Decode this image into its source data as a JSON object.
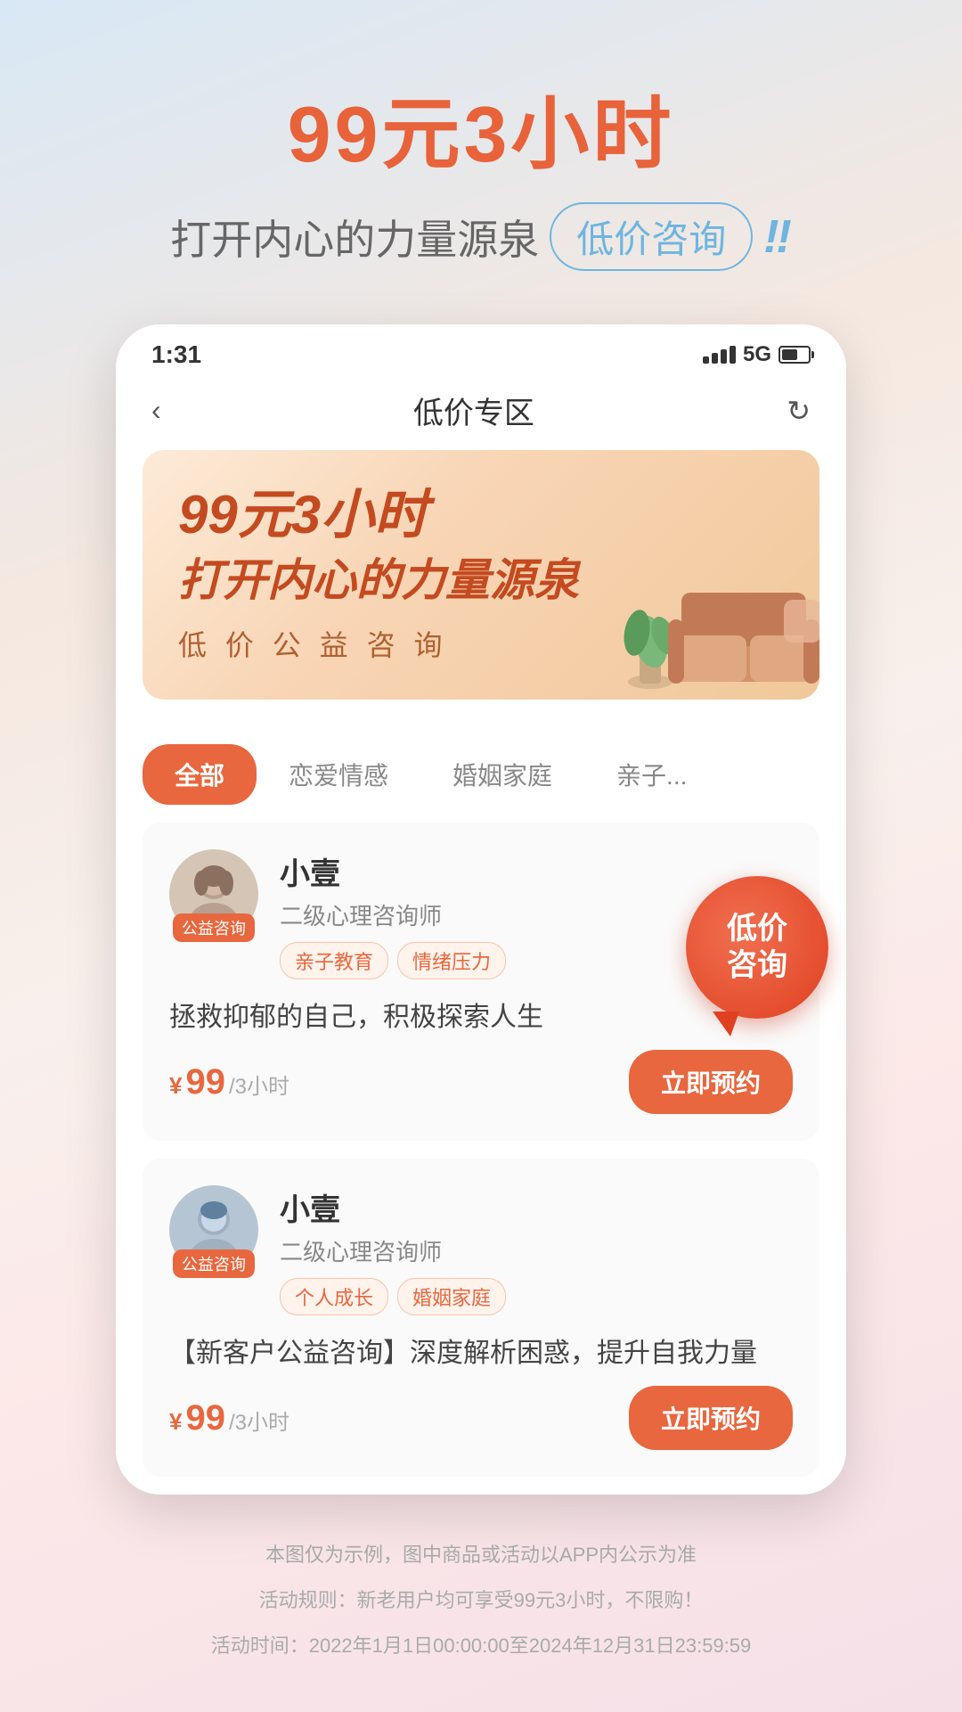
{
  "header": {
    "main_title": "99元3小时",
    "subtitle_text": "打开内心的力量源泉",
    "badge_text": "低价咨询",
    "exclamation": "!!"
  },
  "phone": {
    "status_time": "1:31",
    "signal_text": "5G",
    "nav_title": "低价专区"
  },
  "banner": {
    "line1": "99元3小时",
    "line2": "打开内心的力量源泉",
    "subtitle": "低 价 公 益 咨 询"
  },
  "filters": [
    {
      "label": "全部",
      "active": true
    },
    {
      "label": "恋爱情感",
      "active": false
    },
    {
      "label": "婚姻家庭",
      "active": false
    },
    {
      "label": "亲子...",
      "active": false
    }
  ],
  "float_bubble": {
    "line1": "低价",
    "line2": "咨询"
  },
  "counselors": [
    {
      "name": "小壹",
      "title": "二级心理咨询师",
      "badge": "公益咨询",
      "tags": [
        "亲子教育",
        "情绪压力"
      ],
      "description": "拯救抑郁的自己，积极探索人生",
      "price_amount": "99",
      "price_unit": "/3小时",
      "button_label": "立即预约",
      "gender": "female"
    },
    {
      "name": "小壹",
      "title": "二级心理咨询师",
      "badge": "公益咨询",
      "tags": [
        "个人成长",
        "婚姻家庭"
      ],
      "description": "【新客户公益咨询】深度解析困惑，提升自我力量",
      "price_amount": "99",
      "price_unit": "/3小时",
      "button_label": "立即预约",
      "gender": "male"
    }
  ],
  "footer": {
    "disclaimer": "本图仅为示例，图中商品或活动以APP内公示为准",
    "rule_label": "活动规则：",
    "rule_text": "活动规则：新老用户均可享受99元3小时，不限购！",
    "time_label": "活动时间：",
    "time_text": "活动时间：2022年1月1日00:00:00至2024年12月31日23:59:59"
  }
}
